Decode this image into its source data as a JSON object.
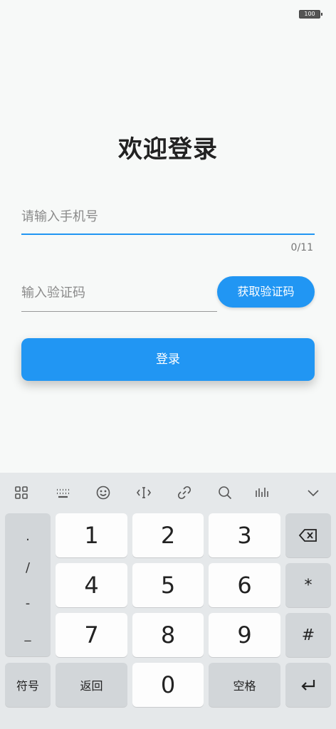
{
  "status_bar": {
    "battery": "100"
  },
  "page": {
    "title": "欢迎登录"
  },
  "phone": {
    "placeholder": "请输入手机号",
    "value": "",
    "counter": "0/11"
  },
  "code": {
    "placeholder": "输入验证码",
    "value": "",
    "get_code_label": "获取验证码"
  },
  "login": {
    "label": "登录"
  },
  "colors": {
    "accent": "#2196f3",
    "background": "#f7f9f8",
    "keyboard": "#e5e8ea"
  },
  "keyboard": {
    "toolbar": [
      "grid-icon",
      "keyboard-icon",
      "emoji-icon",
      "cursor-icon",
      "link-icon",
      "search-icon",
      "voice-bars-icon",
      "chevron-down-icon"
    ],
    "symbols": [
      ".",
      "/",
      "-",
      "_"
    ],
    "digits": [
      "1",
      "2",
      "3",
      "4",
      "5",
      "6",
      "7",
      "8",
      "9",
      "0"
    ],
    "star": "*",
    "hash": "#",
    "symbol_label": "符号",
    "back_label": "返回",
    "space_label": "空格"
  }
}
